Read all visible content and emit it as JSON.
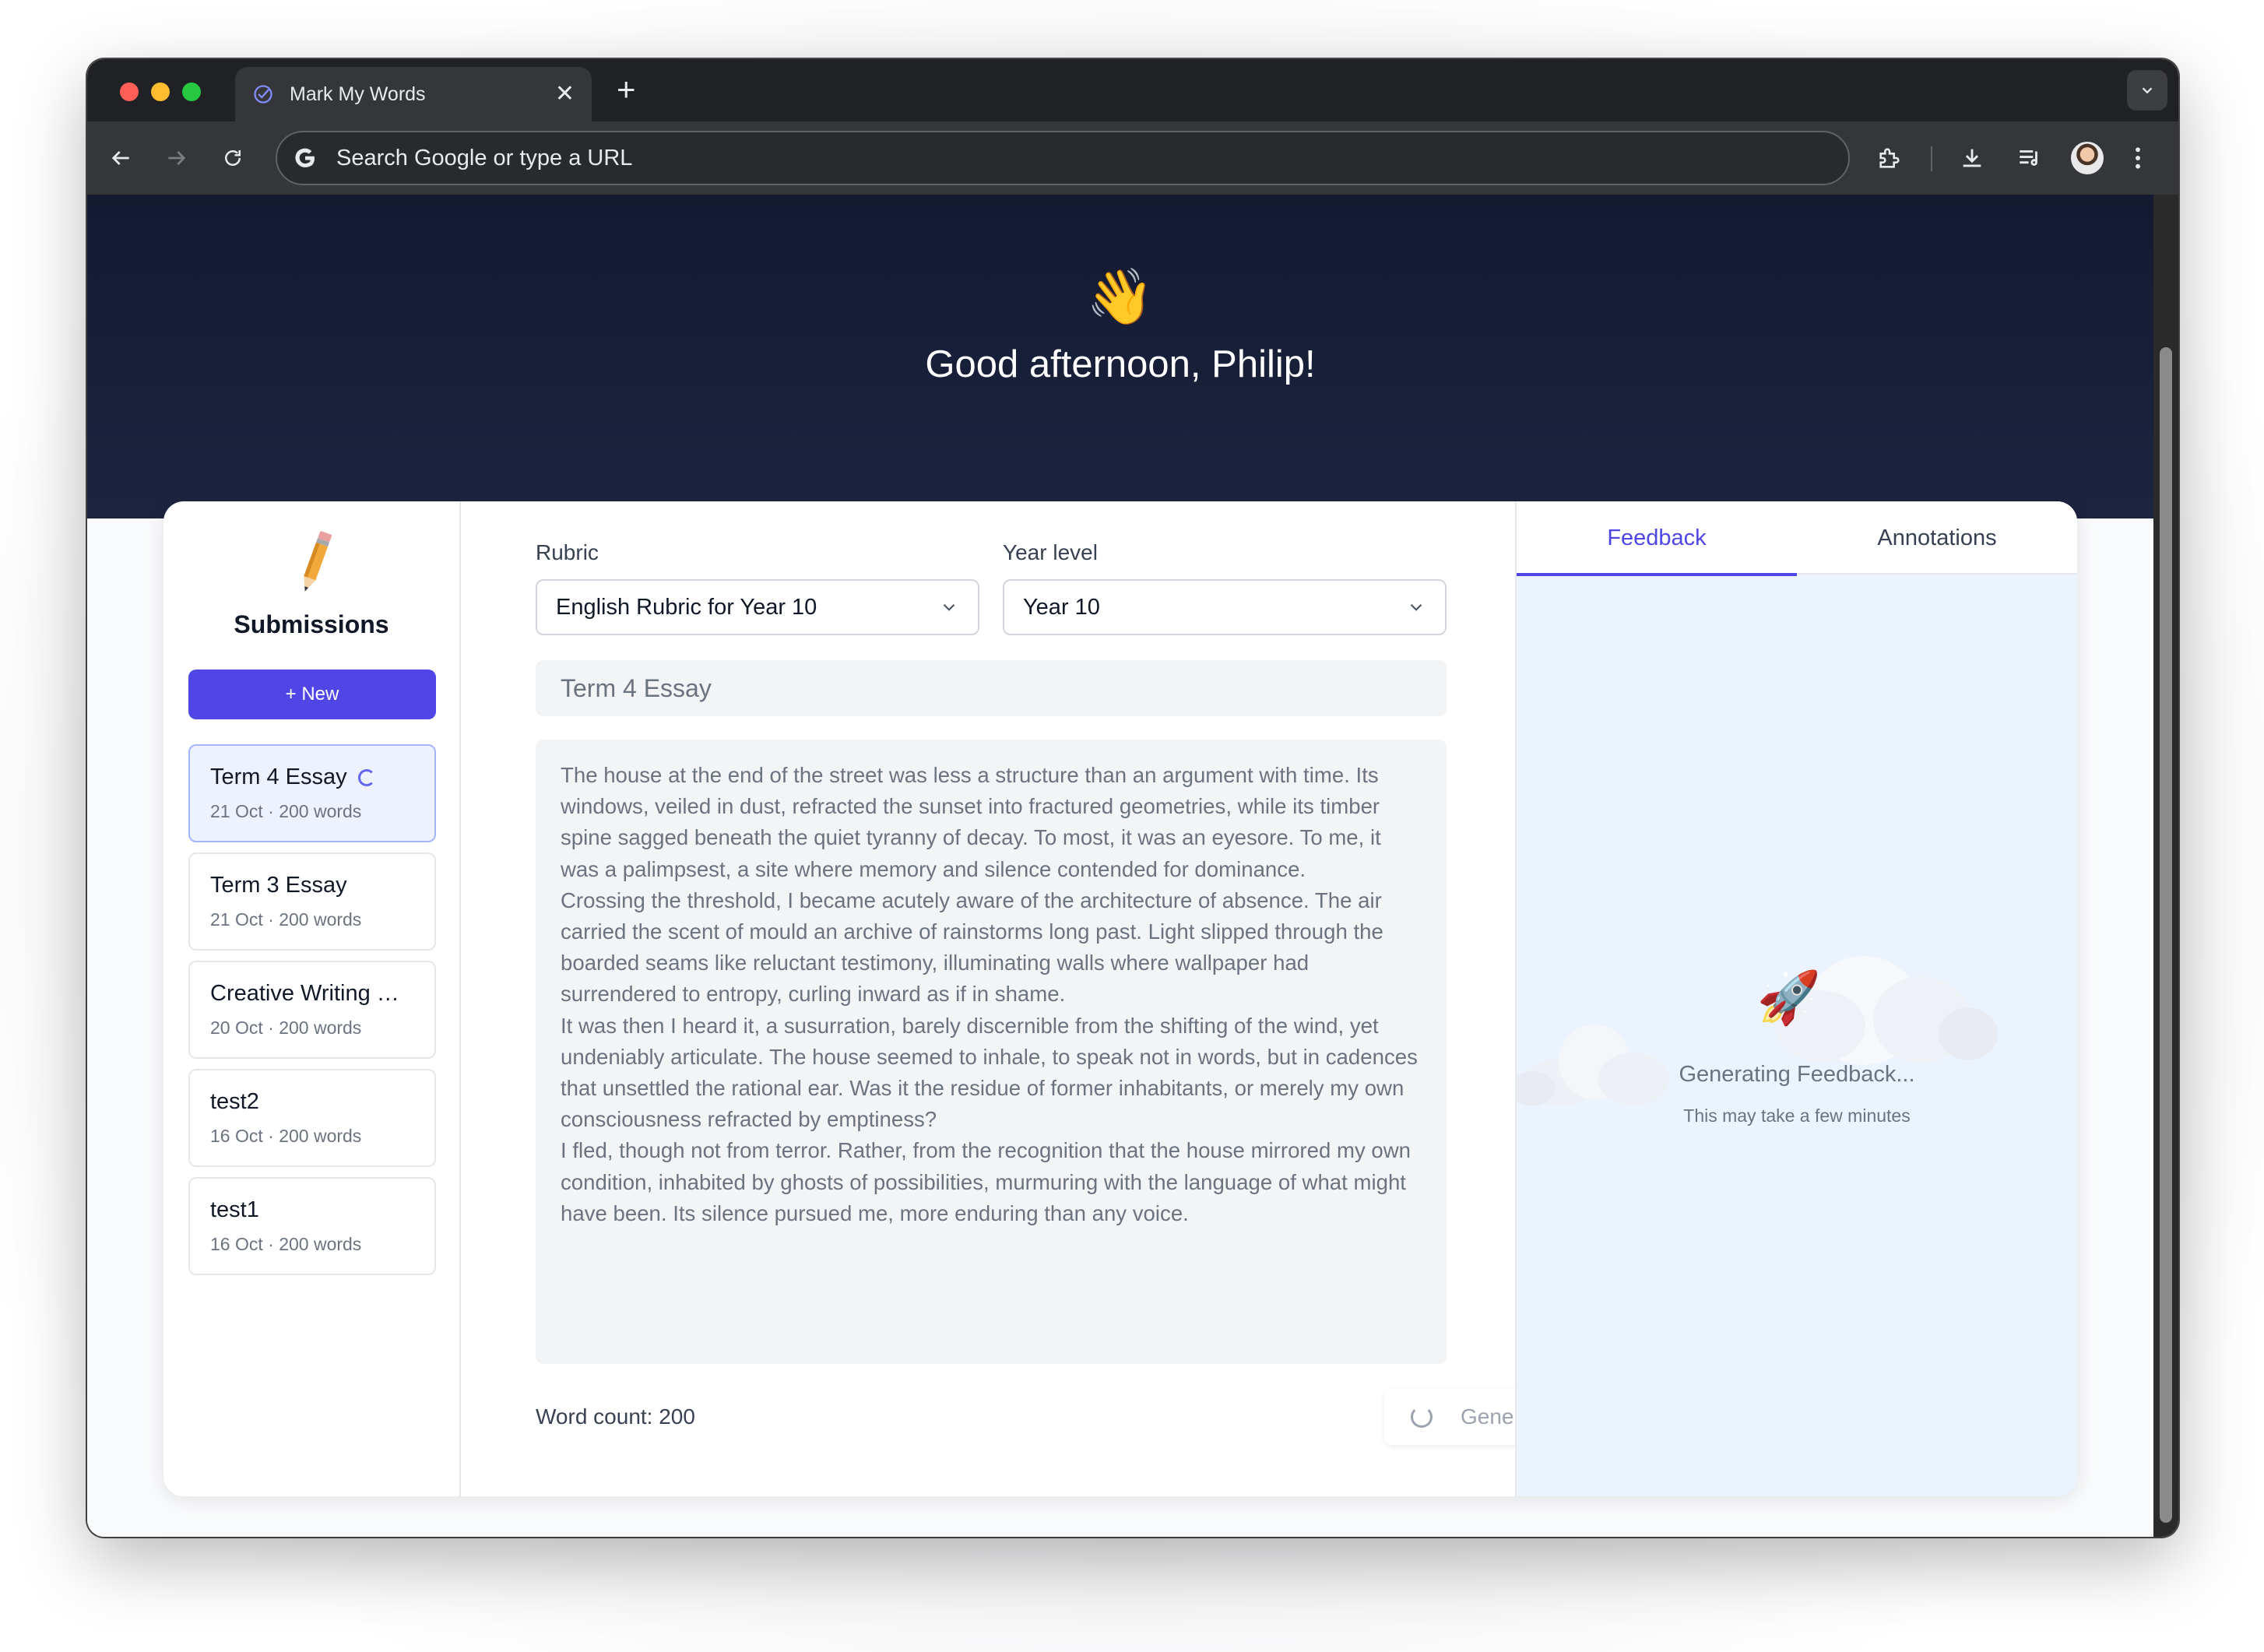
{
  "browser": {
    "tab_title": "Mark My Words",
    "omnibox_placeholder": "Search Google or type a URL"
  },
  "hero": {
    "emoji": "👋",
    "greeting": "Good afternoon, Philip!"
  },
  "sidebar": {
    "title": "Submissions",
    "new_button": "+ New",
    "items": [
      {
        "name": "Term 4 Essay",
        "meta": "21 Oct · 200 words",
        "active": true,
        "loading": true
      },
      {
        "name": "Term 3 Essay",
        "meta": "21 Oct · 200 words"
      },
      {
        "name": "Creative Writing …",
        "meta": "20 Oct · 200 words"
      },
      {
        "name": "test2",
        "meta": "16 Oct · 200 words"
      },
      {
        "name": "test1",
        "meta": "16 Oct · 200 words"
      }
    ]
  },
  "editor": {
    "rubric_label": "Rubric",
    "rubric_value": "English Rubric for Year 10",
    "year_label": "Year level",
    "year_value": "Year 10",
    "title": "Term 4 Essay",
    "essay_paragraphs": [
      "The house at the end of the street was less a structure than an argument with time. Its windows, veiled in dust, refracted the sunset into fractured geometries, while its timber spine sagged beneath the quiet tyranny of decay. To most, it was an eyesore. To me, it was a palimpsest, a site where memory and silence contended for dominance.",
      "Crossing the threshold, I became acutely aware of the architecture of absence. The air carried the scent of mould an archive of rainstorms long past. Light slipped through the boarded seams like reluctant testimony, illuminating walls where wallpaper had surrendered to entropy, curling inward as if in shame.",
      "It was then I heard it, a susurration, barely discernible from the shifting of the wind, yet undeniably articulate. The house seemed to inhale, to speak not in words, but in cadences that unsettled the rational ear. Was it the residue of former inhabitants, or merely my own consciousness refracted by emptiness?",
      "I fled, though not from terror. Rather, from the recognition that the house mirrored my own condition, inhabited by ghosts of possibilities, murmuring with the language of what might have been. Its silence pursued me, more enduring than any voice."
    ],
    "word_count": "Word count: 200",
    "generate_button": "Generating..."
  },
  "feedback": {
    "tabs": [
      "Feedback",
      "Annotations"
    ],
    "active_tab": "Feedback",
    "status": "Generating Feedback...",
    "status_sub": "This may take a few minutes",
    "rocket": "🚀"
  },
  "colors": {
    "accent": "#4f46e5",
    "hero_bg": "#141a30",
    "feedback_bg": "#eaf3fe"
  }
}
